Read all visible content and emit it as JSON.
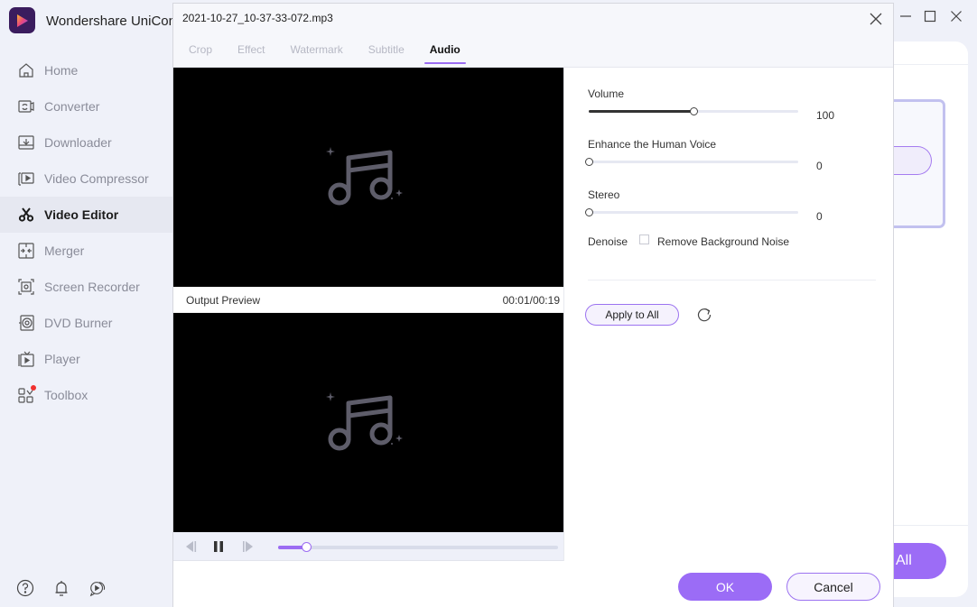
{
  "app": {
    "title": "Wondershare UniConverter",
    "window_controls": {
      "minimize": "minimize-icon",
      "maximize": "maximize-icon",
      "close": "close-icon"
    }
  },
  "sidebar": {
    "items": [
      {
        "label": "Home",
        "icon": "home-icon",
        "active": false
      },
      {
        "label": "Converter",
        "icon": "converter-icon",
        "active": false
      },
      {
        "label": "Downloader",
        "icon": "downloader-icon",
        "active": false
      },
      {
        "label": "Video Compressor",
        "icon": "video-compressor-icon",
        "active": false
      },
      {
        "label": "Video Editor",
        "icon": "scissors-icon",
        "active": true
      },
      {
        "label": "Merger",
        "icon": "merger-icon",
        "active": false
      },
      {
        "label": "Screen Recorder",
        "icon": "screen-recorder-icon",
        "active": false
      },
      {
        "label": "DVD Burner",
        "icon": "dvd-icon",
        "active": false
      },
      {
        "label": "Player",
        "icon": "player-icon",
        "active": false
      },
      {
        "label": "Toolbox",
        "icon": "toolbox-icon",
        "active": false,
        "badge": true
      }
    ],
    "bottom_icons": [
      "help-icon",
      "bell-icon",
      "feedback-icon"
    ]
  },
  "background": {
    "convert_all_label": "All"
  },
  "dialog": {
    "title": "2021-10-27_10-37-33-072.mp3",
    "tabs": [
      {
        "label": "Crop",
        "active": false
      },
      {
        "label": "Effect",
        "active": false
      },
      {
        "label": "Watermark",
        "active": false
      },
      {
        "label": "Subtitle",
        "active": false
      },
      {
        "label": "Audio",
        "active": true
      }
    ],
    "preview": {
      "output_label": "Output Preview",
      "time": "00:01/00:19",
      "progress_fraction": 0.1
    },
    "audio": {
      "volume": {
        "label": "Volume",
        "value": "100",
        "fraction": 0.5
      },
      "enhance_voice": {
        "label": "Enhance the Human Voice",
        "value": "0",
        "fraction": 0
      },
      "stereo": {
        "label": "Stereo",
        "value": "0",
        "fraction": 0
      },
      "denoise": {
        "label": "Denoise",
        "checkbox_label": "Remove Background Noise",
        "checked": false
      },
      "apply_all_label": "Apply to All"
    },
    "ok_label": "OK",
    "cancel_label": "Cancel"
  },
  "colors": {
    "accent": "#9b6cf6",
    "sidebar_bg": "#eff1f9",
    "badge": "#f0302f"
  }
}
